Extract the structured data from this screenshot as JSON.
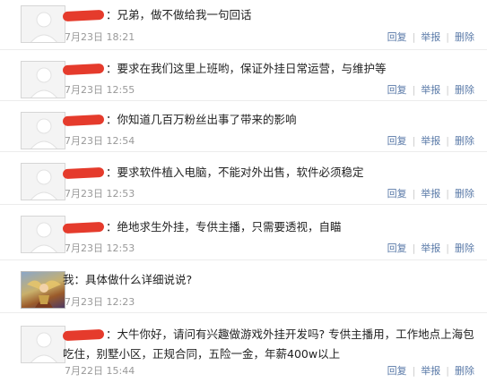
{
  "actions": {
    "reply": "回复",
    "report": "举报",
    "delete": "删除"
  },
  "messages": [
    {
      "text": "兄弟，做不做给我一句回话",
      "time": "7月23日 18:21"
    },
    {
      "text": "要求在我们这里上班哟，保证外挂日常运营，与维护等",
      "time": "7月23日 12:55"
    },
    {
      "text": "你知道几百万粉丝出事了带来的影响",
      "time": "7月23日 12:54"
    },
    {
      "text": "要求软件植入电脑，不能对外出售，软件必须稳定",
      "time": "7月23日 12:53"
    },
    {
      "text": "绝地求生外挂，专供主播，只需要透视，自瞄",
      "time": "7月23日 12:53"
    },
    {
      "sender": "我：",
      "text": "具体做什么详细说说?",
      "time": "7月23日 12:23"
    },
    {
      "text": "大牛你好，请问有兴趣做游戏外挂开发吗? 专供主播用，工作地点上海包吃住，别墅小区，正规合同，五险一金，年薪400w以上",
      "time": "7月22日 15:44"
    }
  ]
}
